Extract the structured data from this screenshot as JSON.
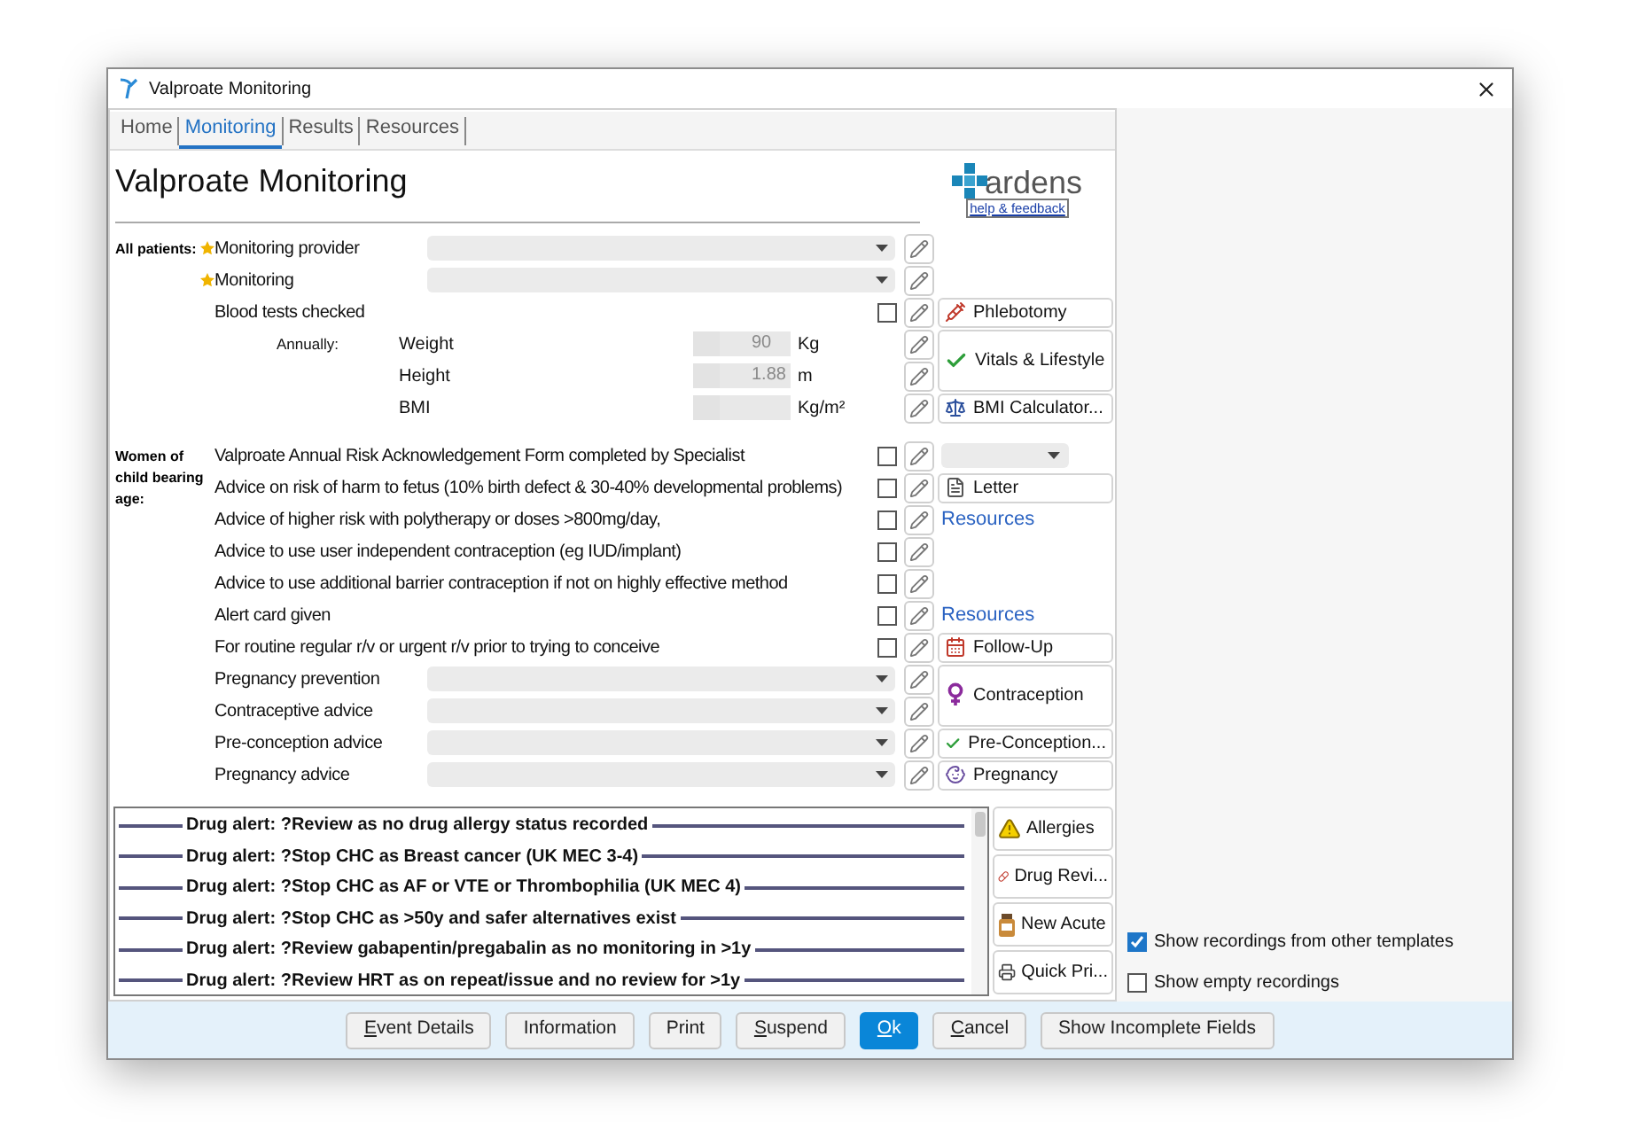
{
  "window": {
    "title": "Valproate Monitoring"
  },
  "tabs": [
    {
      "label": "Home",
      "selected": false
    },
    {
      "label": "Monitoring",
      "selected": true
    },
    {
      "label": "Results",
      "selected": false
    },
    {
      "label": "Resources",
      "selected": false
    }
  ],
  "header": {
    "title": "Valproate Monitoring",
    "logo": "ardens",
    "help_link": "help & feedback"
  },
  "sections": [
    {
      "label": "All patients:",
      "rows": [
        {
          "kind": "select",
          "label": "Monitoring provider",
          "starred": true
        },
        {
          "kind": "select",
          "label": "Monitoring",
          "starred": true
        },
        {
          "kind": "check",
          "label": "Blood tests checked",
          "starred": false,
          "checked": false,
          "side": {
            "kind": "button",
            "label": "Phlebotomy",
            "tall": false
          }
        },
        {
          "kind": "measure",
          "prefix": "Annually:",
          "label": "Weight",
          "starred": false,
          "value": "90",
          "unit": "Kg",
          "side": {
            "kind": "button",
            "label": "Vitals & Lifestyle",
            "tall": true
          }
        },
        {
          "kind": "measure",
          "label": "Height",
          "starred": false,
          "value": "1.88",
          "unit": "m"
        },
        {
          "kind": "measure",
          "label": "BMI",
          "starred": false,
          "unit": "Kg/m²",
          "side": {
            "kind": "button",
            "label": "BMI Calculator...",
            "tall": false
          }
        }
      ]
    },
    {
      "label": "Women of child bearing age:",
      "rows": [
        {
          "kind": "check",
          "label": "Valproate Annual Risk Acknowledgement Form completed by Specialist",
          "starred": false,
          "checked": false,
          "side": {
            "kind": "dropdown",
            "tall": false
          }
        },
        {
          "kind": "check",
          "label": "Advice on risk of harm to fetus (10% birth defect & 30-40% developmental problems)",
          "starred": false,
          "checked": false,
          "side": {
            "kind": "button",
            "label": "Letter",
            "tall": false
          }
        },
        {
          "kind": "check",
          "label": "Advice of higher risk with polytherapy or doses >800mg/day,",
          "starred": false,
          "checked": false,
          "side": {
            "kind": "link",
            "label": "Resources",
            "tall": false
          }
        },
        {
          "kind": "check",
          "label": "Advice to use user independent contraception (eg IUD/implant)",
          "starred": false,
          "checked": false
        },
        {
          "kind": "check",
          "label": "Advice to use additional barrier contraception if not on highly effective method",
          "starred": false,
          "checked": false
        },
        {
          "kind": "check",
          "label": "Alert card given",
          "starred": false,
          "checked": false,
          "side": {
            "kind": "link",
            "label": "Resources",
            "tall": false
          }
        },
        {
          "kind": "check",
          "label": "For routine regular r/v or urgent r/v prior to trying to conceive",
          "starred": false,
          "checked": false,
          "side": {
            "kind": "button",
            "label": "Follow-Up",
            "tall": false
          }
        },
        {
          "kind": "select",
          "label": "Pregnancy prevention",
          "starred": false,
          "side": {
            "kind": "button",
            "label": "Contraception",
            "tall": true
          }
        },
        {
          "kind": "select",
          "label": "Contraceptive advice",
          "starred": false
        },
        {
          "kind": "select",
          "label": "Pre-conception advice",
          "starred": false,
          "side": {
            "kind": "button",
            "label": "Pre-Conception...",
            "tall": false
          }
        },
        {
          "kind": "select",
          "label": "Pregnancy advice",
          "starred": false,
          "side": {
            "kind": "button",
            "label": "Pregnancy",
            "tall": false
          }
        }
      ]
    }
  ],
  "alerts": [
    "Drug alert: ?Review as no drug allergy status recorded",
    "Drug alert: ?Stop CHC as Breast cancer (UK MEC 3-4)",
    "Drug alert: ?Stop CHC as AF or VTE or Thrombophilia (UK MEC 4)",
    "Drug alert: ?Stop CHC as >50y and safer alternatives exist",
    "Drug alert: ?Review gabapentin/pregabalin as no monitoring in >1y",
    "Drug alert: ?Review HRT as on repeat/issue and no review for >1y"
  ],
  "alert_actions": [
    "Allergies",
    "Drug Revi...",
    "New Acute",
    "Quick Pri..."
  ],
  "options": [
    {
      "label": "Show recordings from other templates",
      "checked": true
    },
    {
      "label": "Show empty recordings",
      "checked": false
    }
  ],
  "buttons": [
    {
      "label": "Event Details",
      "underline_first": true,
      "primary": false
    },
    {
      "label": "Information",
      "underline_first": false,
      "primary": false
    },
    {
      "label": "Print",
      "underline_first": false,
      "primary": false
    },
    {
      "label": "Suspend",
      "underline_first": true,
      "primary": false
    },
    {
      "label": "Ok",
      "underline_first": true,
      "primary": true
    },
    {
      "label": "Cancel",
      "underline_first": true,
      "primary": false
    },
    {
      "label": "Show Incomplete Fields",
      "underline_first": false,
      "primary": false
    }
  ]
}
